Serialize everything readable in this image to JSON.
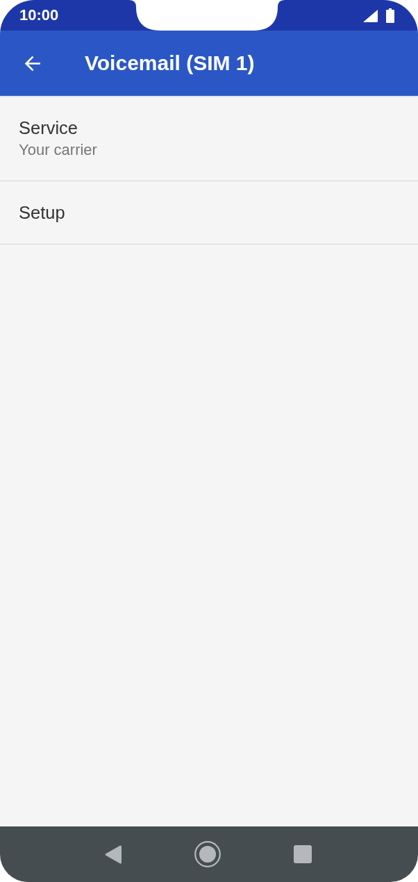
{
  "status_bar": {
    "time": "10:00"
  },
  "app_bar": {
    "title": "Voicemail (SIM 1)"
  },
  "items": [
    {
      "title": "Service",
      "summary": "Your carrier"
    },
    {
      "title": "Setup"
    }
  ]
}
